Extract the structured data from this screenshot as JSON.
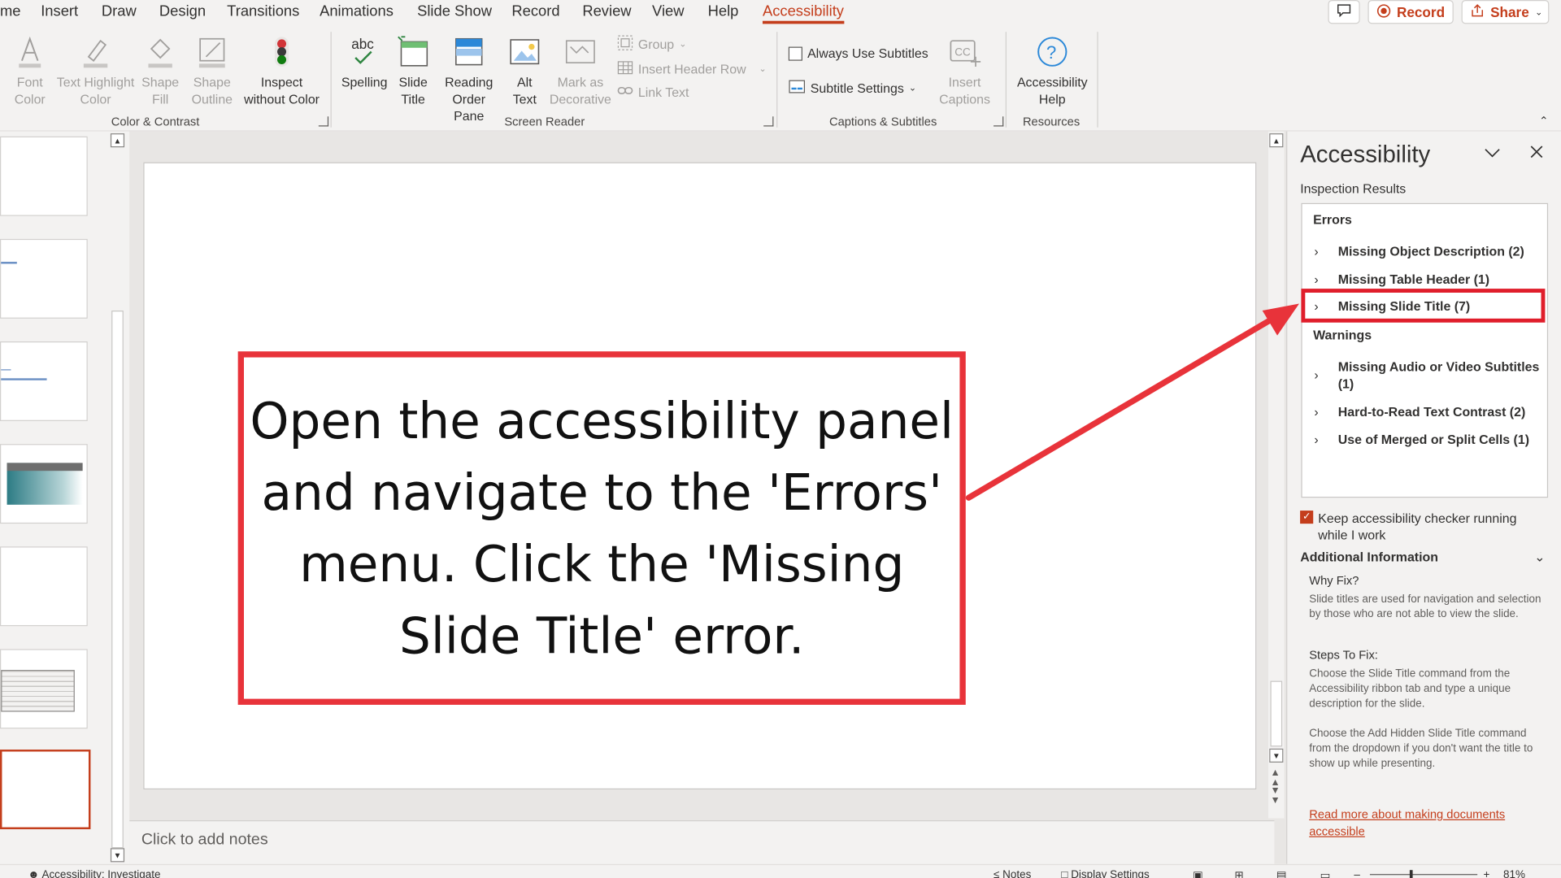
{
  "menu": {
    "tabs": [
      "me",
      "Insert",
      "Draw",
      "Design",
      "Transitions",
      "Animations",
      "Slide Show",
      "Record",
      "Review",
      "View",
      "Help",
      "Accessibility"
    ],
    "record_label": "Record",
    "share_label": "Share"
  },
  "ribbon": {
    "color_contrast": {
      "font_color": "Font Color",
      "text_highlight_color": "Text Highlight Color",
      "shape_fill": "Shape Fill",
      "shape_outline": "Shape Outline",
      "inspect": "Inspect without Color",
      "group_label": "Color & Contrast"
    },
    "screen_reader": {
      "spelling": "Spelling",
      "slide_title": "Slide Title",
      "reading_order": "Reading Order Pane",
      "alt_text": "Alt Text",
      "mark_decorative": "Mark as Decorative",
      "group": "Group",
      "insert_header_row": "Insert Header Row",
      "link_text": "Link Text",
      "group_label": "Screen Reader"
    },
    "captions": {
      "always_use_subtitles": "Always Use Subtitles",
      "subtitle_settings": "Subtitle Settings",
      "insert_captions": "Insert Captions",
      "group_label": "Captions & Subtitles"
    },
    "resources": {
      "accessibility_help": "Accessibility Help",
      "group_label": "Resources"
    }
  },
  "slide": {
    "callout_text": "Open the accessibility panel and navigate to the 'Errors' menu. Click the 'Missing Slide Title' error.",
    "notes_placeholder": "Click to add notes"
  },
  "pane": {
    "title": "Accessibility",
    "subtitle": "Inspection Results",
    "errors_heading": "Errors",
    "errors": [
      "Missing Object Description (2)",
      "Missing Table Header (1)",
      "Missing Slide Title (7)"
    ],
    "warnings_heading": "Warnings",
    "warnings": [
      "Missing Audio or Video Subtitles (1)",
      "Hard-to-Read Text Contrast (2)",
      "Use of Merged or Split Cells (1)"
    ],
    "keep_running": "Keep accessibility checker running while I work",
    "additional_info": "Additional Information",
    "why_fix_heading": "Why Fix?",
    "why_fix_text": "Slide titles are used for navigation and selection by those who are not able to view the slide.",
    "steps_heading": "Steps To Fix:",
    "steps_text_1": "Choose the Slide Title command from the Accessibility ribbon tab and type a unique description for the slide.",
    "steps_text_2": "Choose the Add Hidden Slide Title command from the dropdown if you don't want the title to show up while presenting.",
    "read_more": "Read more about making documents accessible"
  },
  "status": {
    "accessibility": "Accessibility: Investigate",
    "notes": "Notes",
    "display_settings": "Display Settings",
    "zoom": "81%"
  },
  "colors": {
    "accent": "#c43e1c",
    "callout_border": "#e8333a",
    "highlight_border": "#e01e2b"
  }
}
